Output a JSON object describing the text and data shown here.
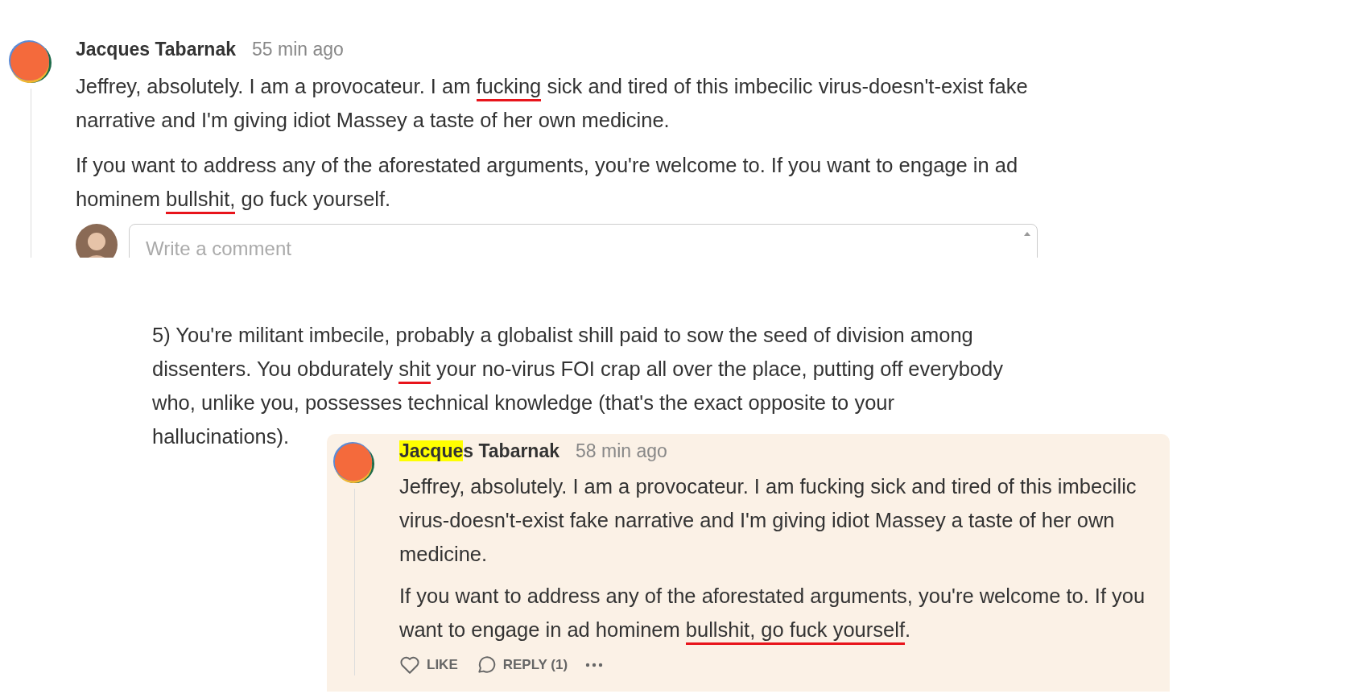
{
  "top_comment": {
    "author": [
      {
        "text": "Jacques Tabarnak",
        "highlighted": false
      }
    ],
    "time": "55 min ago",
    "paragraphs": [
      [
        {
          "text": "Jeffrey, absolutely. I am a provocateur. I am ",
          "marked": false
        },
        {
          "text": "fucking",
          "marked": true
        },
        {
          "text": " sick and tired of this imbecilic virus-doesn't-exist fake narrative and I'm giving idiot Massey a taste of her own medicine.",
          "marked": false
        }
      ],
      [
        {
          "text": "If you want to address any of the aforestated arguments, you're welcome to. If you want to engage in ad hominem ",
          "marked": false
        },
        {
          "text": "bullshit,",
          "marked": true
        },
        {
          "text": " go fuck yourself.",
          "marked": false
        }
      ]
    ],
    "reply_field": {
      "placeholder": "Write a comment"
    }
  },
  "excerpt": {
    "paragraphs": [
      [
        {
          "text": "5) You're militant imbecile, probably a globalist shill paid to sow the seed of division among dissenters. You obdurately ",
          "marked": false
        },
        {
          "text": "shit",
          "marked": true
        },
        {
          "text": " your no-virus FOI crap all over the place, putting off everybody who, unlike you, possesses technical knowledge (that's the exact opposite to your hallucinations).",
          "marked": false
        }
      ]
    ]
  },
  "reply_comment": {
    "author": [
      {
        "text": "Jacque",
        "highlighted": true
      },
      {
        "text": "s Tabarnak",
        "highlighted": false
      }
    ],
    "time": "58 min ago",
    "paragraphs": [
      [
        {
          "text": "Jeffrey, absolutely. I am a provocateur. I am fucking sick and tired of this imbecilic virus-doesn't-exist fake narrative and I'm giving idiot Massey a taste of her own medicine.",
          "marked": false
        }
      ],
      [
        {
          "text": "If you want to address any of the aforestated arguments, you're welcome to. If you want to engage in ad hominem ",
          "marked": false
        },
        {
          "text": "bullshit, go fuck yourself",
          "marked": true
        },
        {
          "text": ".",
          "marked": false
        }
      ]
    ],
    "actions": [
      {
        "kind": "like",
        "label": "LIKE"
      },
      {
        "kind": "reply",
        "label": "REPLY (1)"
      },
      {
        "kind": "more"
      }
    ]
  }
}
